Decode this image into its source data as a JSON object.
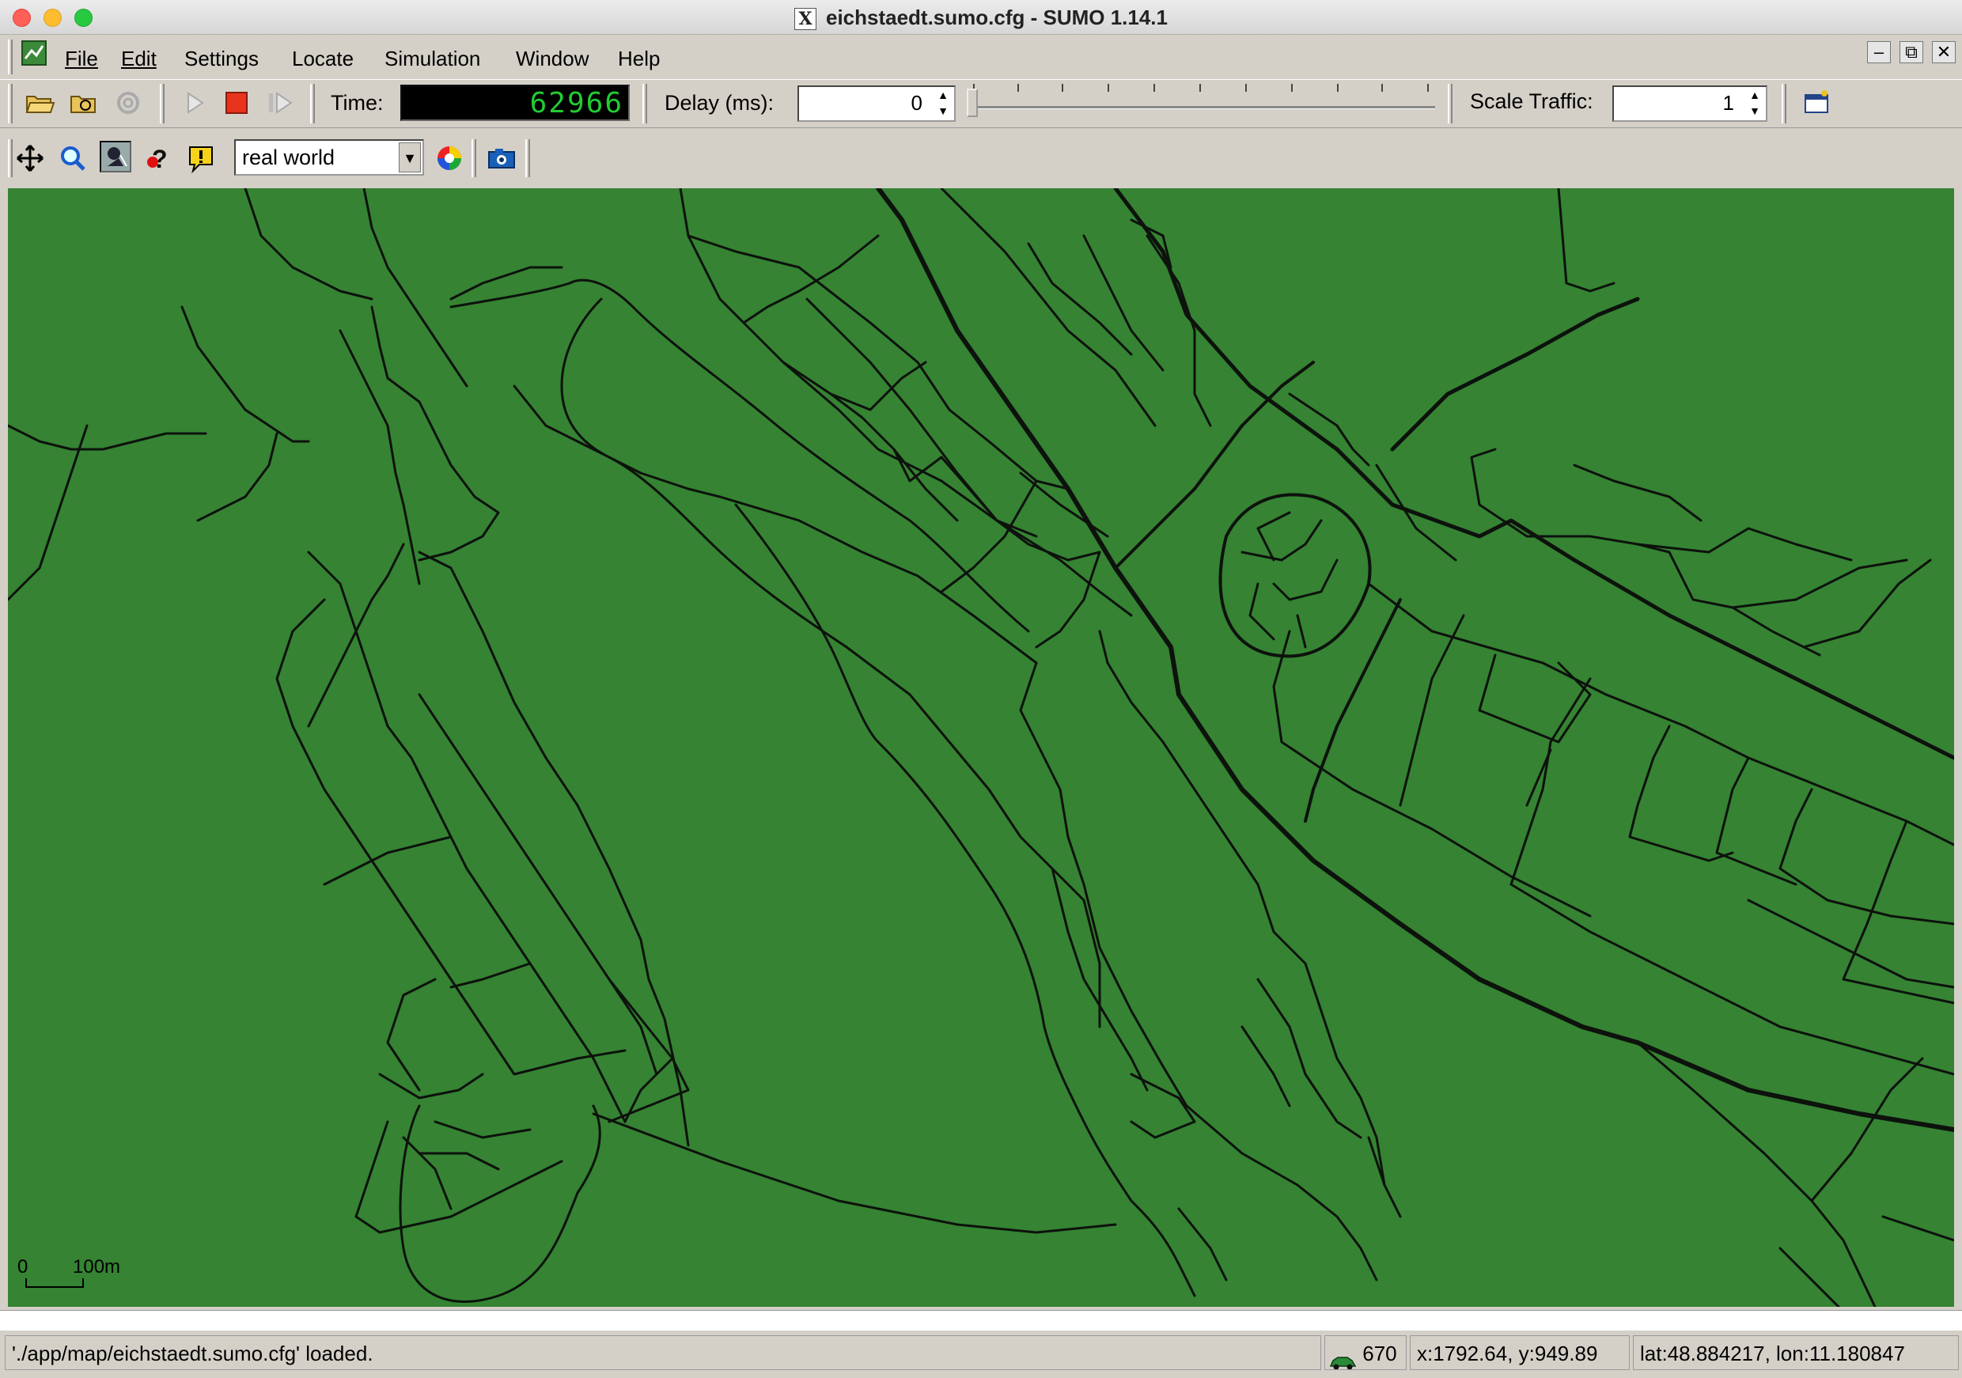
{
  "window": {
    "title": "eichstaedt.sumo.cfg - SUMO 1.14.1",
    "x_logo": "X"
  },
  "menu": {
    "file": "File",
    "edit": "Edit",
    "settings": "Settings",
    "locate": "Locate",
    "simulation": "Simulation",
    "window": "Window",
    "help": "Help"
  },
  "window_controls": {
    "minimize": "–",
    "restore": "⧉",
    "close": "✕"
  },
  "toolbar": {
    "time_label": "Time:",
    "time_value": "62966",
    "delay_label": "Delay (ms):",
    "delay_value": "0",
    "scale_label": "Scale Traffic:",
    "scale_value": "1"
  },
  "view_toolbar": {
    "color_scheme": "real world"
  },
  "map": {
    "background": "#358333",
    "road_color": "#0d120c",
    "scale_zero": "0",
    "scale_label": "100m"
  },
  "status": {
    "message": "'./app/map/eichstaedt.sumo.cfg' loaded.",
    "vehicle_count": "670",
    "coords": "x:1792.64, y:949.89",
    "latlon": "lat:48.884217, lon:11.180847"
  },
  "colors": {
    "close": "#ff5f57",
    "minimize": "#febc2e",
    "zoom": "#28c840",
    "stop": "#e8341c",
    "time_digits": "#22cc33"
  }
}
